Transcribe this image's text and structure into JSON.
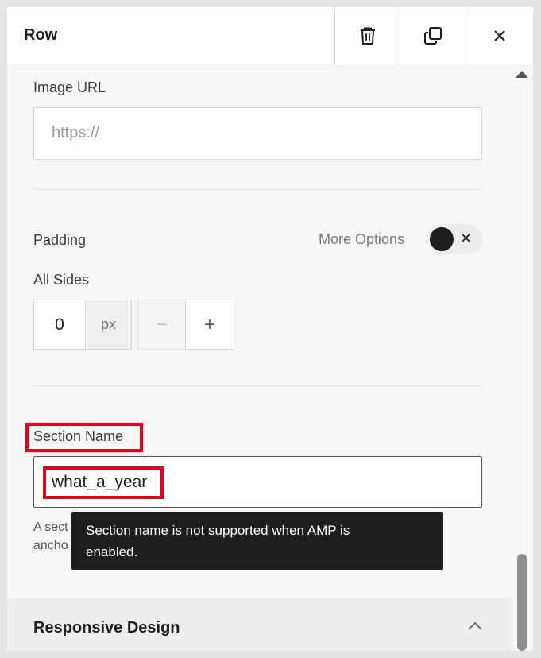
{
  "header": {
    "title": "Row",
    "icons": [
      "trash-icon",
      "duplicate-icon",
      "close-icon"
    ]
  },
  "image_url": {
    "label": "Image URL",
    "placeholder": "https://"
  },
  "padding": {
    "label": "Padding",
    "more_options_label": "More Options",
    "toggle_state": "off",
    "all_sides_label": "All Sides",
    "value": "0",
    "unit": "px",
    "minus": "−",
    "plus": "+"
  },
  "section_name": {
    "label": "Section Name",
    "value": "what_a_year",
    "help_line1": "A sect",
    "help_line2": "ancho",
    "tooltip_line1": "Section name is not supported when AMP is",
    "tooltip_line2": "enabled."
  },
  "responsive": {
    "title": "Responsive Design"
  },
  "colors": {
    "highlight": "#e8001c",
    "tooltip_bg": "#1e1e1e"
  }
}
